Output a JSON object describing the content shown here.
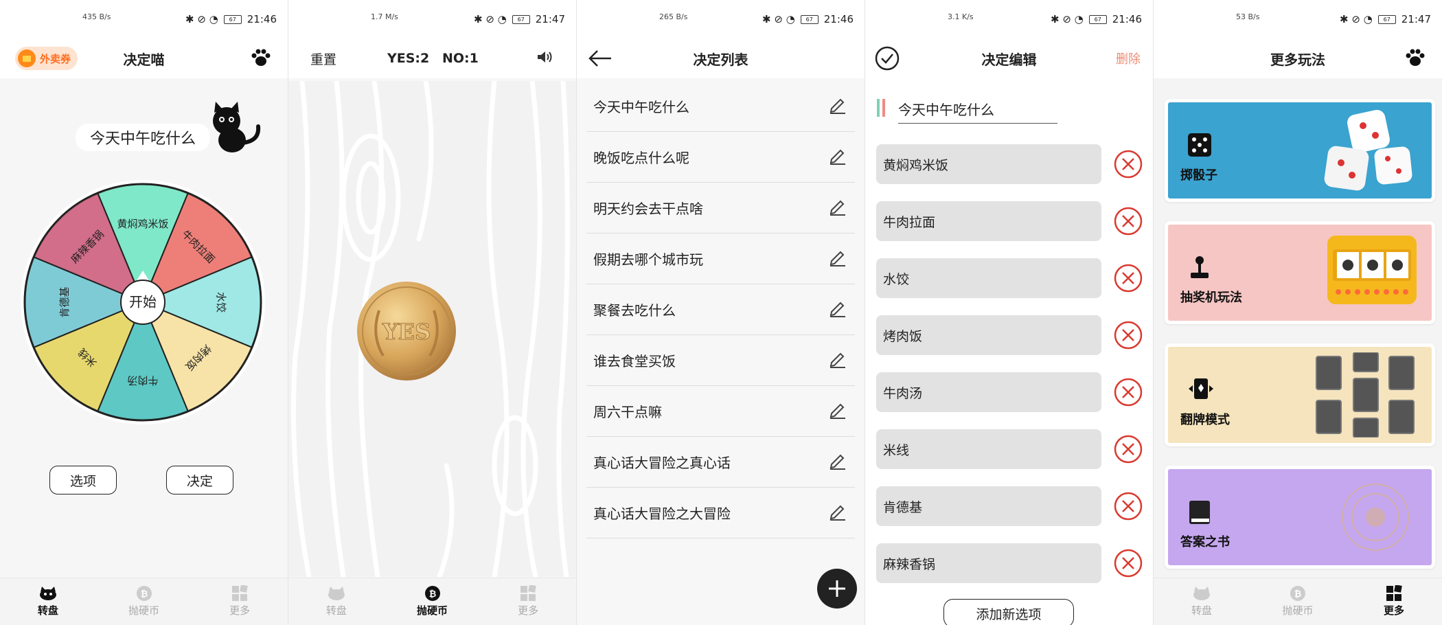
{
  "status_bars": [
    {
      "net": "435 B/s",
      "time": "21:46",
      "battery": "67"
    },
    {
      "net": "1.7 M/s",
      "time": "21:47",
      "battery": "67"
    },
    {
      "net": "265 B/s",
      "time": "21:46",
      "battery": "67"
    },
    {
      "net": "3.1 K/s",
      "time": "21:46",
      "battery": "67"
    },
    {
      "net": "53 B/s",
      "time": "21:47",
      "battery": "67"
    }
  ],
  "wheel_screen": {
    "coupon_label": "外卖券",
    "title": "决定喵",
    "question": "今天中午吃什么",
    "center_label": "开始",
    "segments": [
      {
        "label": "黄焖鸡米饭",
        "color": "#7fe8c8"
      },
      {
        "label": "牛肉拉面",
        "color": "#ee7f78"
      },
      {
        "label": "水饺",
        "color": "#9fe8e6"
      },
      {
        "label": "烤肉饭",
        "color": "#f7e3a8"
      },
      {
        "label": "牛肉汤",
        "color": "#5ec8c4"
      },
      {
        "label": "米线",
        "color": "#e6d86d"
      },
      {
        "label": "肯德基",
        "color": "#7ecbd6"
      },
      {
        "label": "麻辣香锅",
        "color": "#d26d8a"
      }
    ],
    "options_button": "选项",
    "decide_button": "决定"
  },
  "coin_screen": {
    "reset_label": "重置",
    "yes_count": "YES:2",
    "no_count": "NO:1",
    "coin_text": "YES"
  },
  "list_screen": {
    "title": "决定列表",
    "items": [
      "今天中午吃什么",
      "晚饭吃点什么呢",
      "明天约会去干点啥",
      "假期去哪个城市玩",
      "聚餐去吃什么",
      "谁去食堂买饭",
      "周六干点嘛",
      "真心话大冒险之真心话",
      "真心话大冒险之大冒险"
    ]
  },
  "edit_screen": {
    "title": "决定编辑",
    "delete_label": "删除",
    "decision_title": "今天中午吃什么",
    "options": [
      "黄焖鸡米饭",
      "牛肉拉面",
      "水饺",
      "烤肉饭",
      "牛肉汤",
      "米线",
      "肯德基",
      "麻辣香锅"
    ],
    "add_button": "添加新选项"
  },
  "more_screen": {
    "title": "更多玩法",
    "cards": [
      {
        "label": "掷骰子",
        "color": "#3aa3cf"
      },
      {
        "label": "抽奖机玩法",
        "color": "#f6c6c4"
      },
      {
        "label": "翻牌模式",
        "color": "#f5e4bd"
      },
      {
        "label": "答案之书",
        "color": "#c4a7ef"
      }
    ]
  },
  "bottom_nav": {
    "wheel": "转盘",
    "coin": "抛硬币",
    "more": "更多"
  }
}
